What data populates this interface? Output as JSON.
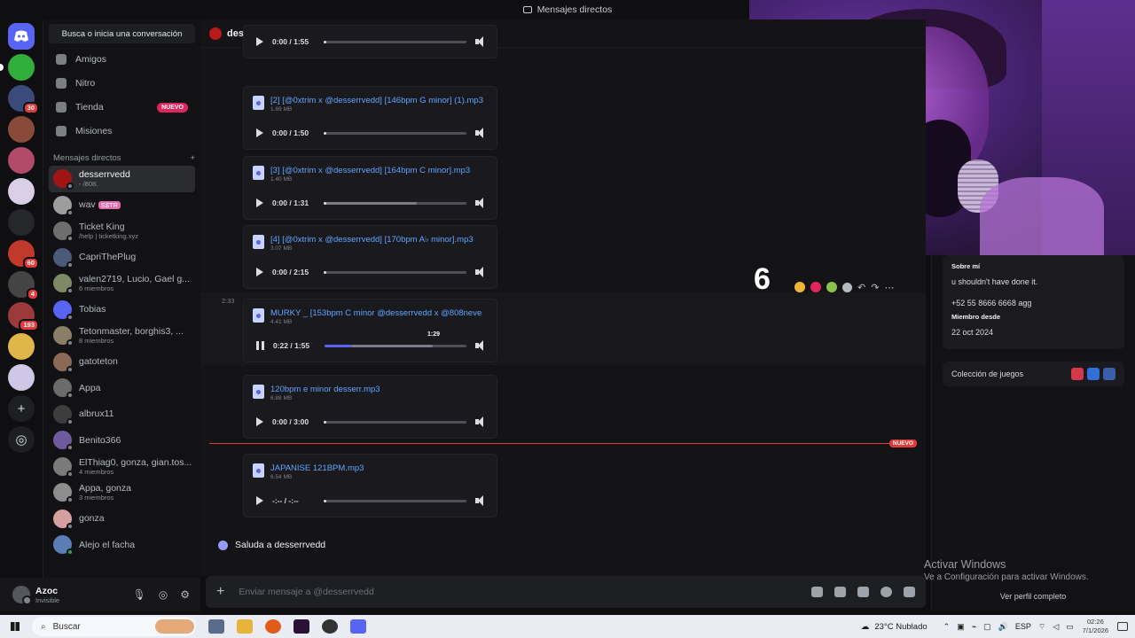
{
  "window": {
    "title": "Mensajes directos"
  },
  "sidebar": {
    "search_label": "Busca o inicia una conversación",
    "nav": [
      {
        "label": "Amigos",
        "icon": "friends-icon"
      },
      {
        "label": "Nitro",
        "icon": "nitro-icon"
      },
      {
        "label": "Tienda",
        "icon": "shop-icon",
        "tag": "NUEVO"
      },
      {
        "label": "Misiones",
        "icon": "quests-icon"
      }
    ],
    "dm_header": "Mensajes directos",
    "dm_add": "+",
    "dms": [
      {
        "name": "desserrvedd",
        "sub": "- /808.",
        "active": true,
        "color": "#a11414",
        "online": false
      },
      {
        "name": "wav",
        "badge": "S$TR",
        "color": "#9d9d9d",
        "online": false
      },
      {
        "name": "Ticket King",
        "sub": "/help | ticketking.xyz",
        "color": "#6e6e6e",
        "online": false
      },
      {
        "name": "CapriThePlug",
        "color": "#4b5a7a",
        "online": false
      },
      {
        "name": "valen2719, Lucio, Gael g...",
        "sub": "6 miembros",
        "color": "#7d8a66",
        "online": false
      },
      {
        "name": "Tobias",
        "color": "#5865f2",
        "online": false
      },
      {
        "name": "Tetonmaster, borghis3, ...",
        "sub": "8 miembros",
        "color": "#8a7f66",
        "online": false
      },
      {
        "name": "gatoteton",
        "color": "#8a6a54",
        "online": false
      },
      {
        "name": "Appa",
        "color": "#6b6b6b",
        "online": false
      },
      {
        "name": "albrux11",
        "color": "#3d3d3d",
        "online": false
      },
      {
        "name": "Benito366",
        "color": "#6f5aa0",
        "online": false
      },
      {
        "name": "ElThiag0, gonza, gian.tos...",
        "sub": "4 miembros",
        "color": "#7a7a7a",
        "online": false
      },
      {
        "name": "Appa, gonza",
        "sub": "3 miembros",
        "color": "#8d8d8d",
        "online": false
      },
      {
        "name": "gonza",
        "color": "#d7a0a0",
        "online": false
      },
      {
        "name": "Alejo el facha",
        "color": "#5b7db5",
        "online": true
      }
    ]
  },
  "user": {
    "name": "Azoc",
    "status": "Invisible"
  },
  "rail": {
    "servers": [
      {
        "color": "#2fae3d",
        "badge": ""
      },
      {
        "color": "#3a4a7a",
        "badge": "30"
      },
      {
        "color": "#8a4a3a",
        "badge": ""
      },
      {
        "color": "#b24a6a",
        "badge": ""
      },
      {
        "color": "#d9d0e8",
        "badge": ""
      },
      {
        "color": "#26272b",
        "badge": ""
      },
      {
        "color": "#c0392b",
        "badge": "60"
      },
      {
        "color": "#444",
        "badge": "4"
      },
      {
        "color": "#9a3a3a",
        "badge": "193"
      },
      {
        "color": "#e0b64a",
        "badge": ""
      },
      {
        "color": "#cfc7e6",
        "badge": ""
      }
    ]
  },
  "header": {
    "name": "desserrvedd"
  },
  "messages": {
    "timestamp": "2:33",
    "attachments": [
      {
        "name": "",
        "size": "",
        "time": "0:00 / 1:55",
        "progress": 0,
        "playing": false
      },
      {
        "name": "[2] [@0xtrim x @desserrvedd] [146bpm G minor] (1).mp3",
        "size": "1.69 MB",
        "time": "0:00 / 1:50",
        "progress": 0,
        "playing": false
      },
      {
        "name": "[3] [@0xtrim x @desserrvedd] [164bpm C minor].mp3",
        "size": "1.40 MB",
        "time": "0:00 / 1:31",
        "progress": 0,
        "buffered": 0.65,
        "playing": false
      },
      {
        "name": "[4] [@0xtrim x @desserrvedd] [170bpm A♭ minor].mp3",
        "size": "3.07 MB",
        "time": "0:00 / 2:15",
        "progress": 0,
        "playing": false
      },
      {
        "name": "MURKY _ [153bpm C minor @desserrvedd x @808neve",
        "size": "4.41 MB",
        "time": "0:22 / 1:55",
        "progress": 0.19,
        "buffered": 0.76,
        "playing": true,
        "hover_time": "1:29"
      },
      {
        "name": "120bpm e minor desserr.mp3",
        "size": "6.88 MB",
        "time": "0:00 / 3:00",
        "progress": 0,
        "playing": false
      },
      {
        "name": "JAPANISE 121BPM.mp3",
        "size": "6.54 MB",
        "time": "-:-- / -:--",
        "progress": 0,
        "playing": false
      }
    ],
    "new_tag": "NUEVO",
    "wave_prompt": "Saluda a desserrvedd"
  },
  "composer": {
    "placeholder": "Enviar mensaje a @desserrvedd"
  },
  "profile": {
    "about_label": "Sobre mí",
    "about_text": "u shouldn't have done it.",
    "phone": "+52 55 8666 6668 agg",
    "member_since_label": "Miembro desde",
    "member_since": "22 oct 2024",
    "games_label": "Colección de juegos",
    "view_full": "Ver perfil completo"
  },
  "overlay": {
    "number": "6"
  },
  "watermark": {
    "line1": "Activar Windows",
    "line2": "Ve a Configuración para activar Windows."
  },
  "taskbar": {
    "search": "Buscar",
    "weather": "23°C  Nublado",
    "lang": "ESP",
    "time": "02:26",
    "date": "7/1/2026"
  }
}
